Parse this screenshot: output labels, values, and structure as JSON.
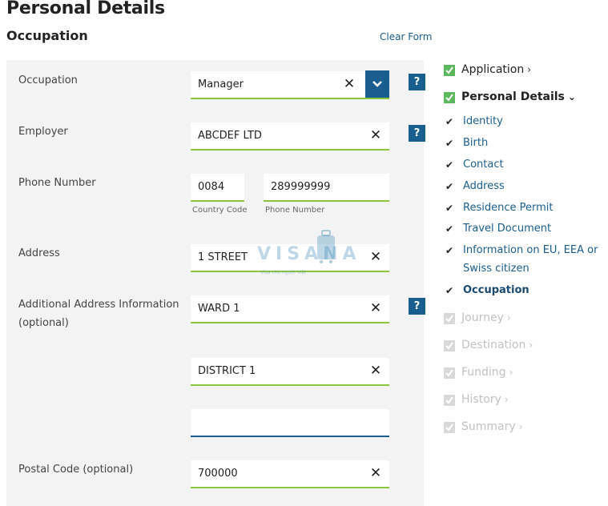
{
  "header": {
    "page_title": "Personal Details",
    "section_title": "Occupation",
    "clear_form": "Clear Form"
  },
  "form": {
    "occupation": {
      "label": "Occupation",
      "value": "Manager",
      "help": "?"
    },
    "employer": {
      "label": "Employer",
      "value": "ABCDEF LTD",
      "help": "?"
    },
    "phone": {
      "label": "Phone Number",
      "country_code_value": "0084",
      "country_code_caption": "Country Code",
      "number_value": "289999999",
      "number_caption": "Phone Number"
    },
    "address": {
      "label": "Address",
      "value": "1 STREET"
    },
    "additional_address": {
      "label_line1": "Additional Address Information",
      "label_line2": "(optional)",
      "line1": "WARD 1",
      "line2": "DISTRICT 1",
      "line3": "",
      "help": "?"
    },
    "postal_code": {
      "label": "Postal Code (optional)",
      "value": "700000"
    },
    "clear_glyph": "✕"
  },
  "watermark": {
    "text": "VISANA",
    "subtext": "Visa cho người Việt"
  },
  "nav": {
    "application": {
      "label": "Application",
      "chevron": "›"
    },
    "personal_details": {
      "label": "Personal Details",
      "chevron": "⌄"
    },
    "sub_items": [
      "Identity",
      "Birth",
      "Contact",
      "Address",
      "Residence Permit",
      "Travel Document",
      "Information on EU, EEA or",
      "Swiss citizen",
      "Occupation"
    ],
    "disabled_items": [
      "Journey",
      "Destination",
      "Funding",
      "History",
      "Summary"
    ],
    "disabled_chevron": "›",
    "check_glyph": "✔"
  },
  "colors": {
    "accent_blue": "#1a5e8f",
    "valid_green": "#8cc63f",
    "check_green": "#5cb85c",
    "panel_grey": "#f3f3f3"
  }
}
